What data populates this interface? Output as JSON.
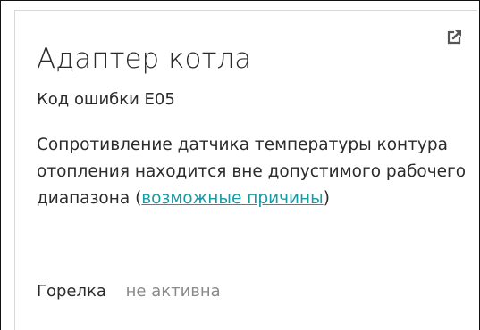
{
  "card": {
    "title": "Адаптер котла",
    "error_code": "Код ошибки E05",
    "description_text": "Сопротивление датчика температуры контура отопления находится вне допустимого рабочего диапазона",
    "open_paren": "(",
    "link_text": "возможные причины",
    "close_paren": ")",
    "open_icon": "external-link-icon",
    "burner_label": "Горелка",
    "burner_status": "не активна",
    "colors": {
      "link": "#1a9aa3",
      "text": "#2b2b2b",
      "muted": "#8a8a8a"
    }
  }
}
